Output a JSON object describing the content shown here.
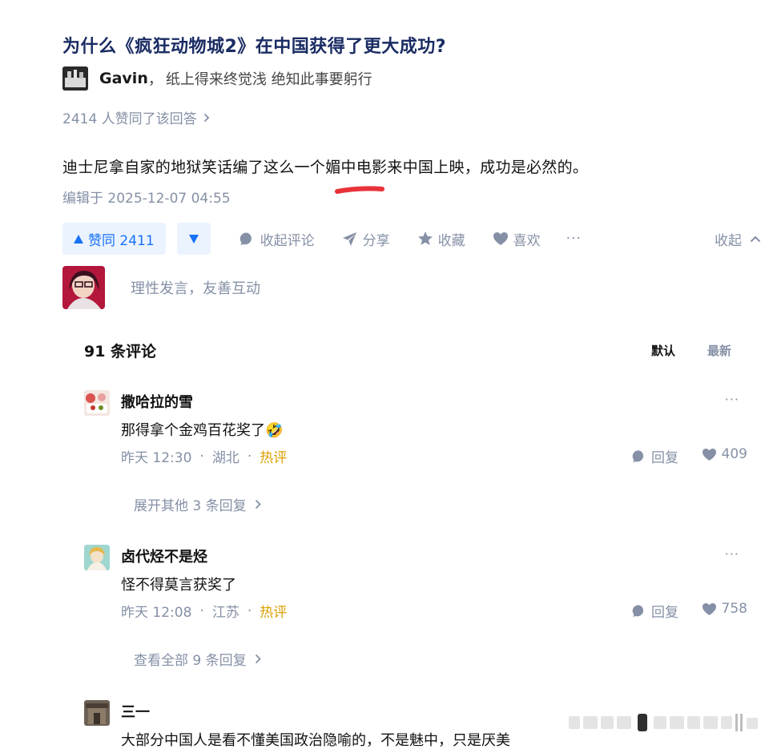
{
  "question": {
    "title": "为什么《疯狂动物城2》在中国获得了更大成功?"
  },
  "author": {
    "name": "Gavin",
    "separator": "，",
    "bio": "纸上得来终觉浅 绝知此事要躬行"
  },
  "upvote_summary": {
    "text": "2414 人赞同了该回答"
  },
  "answer": {
    "content": "迪士尼拿自家的地狱笑话编了这么一个媚中电影来中国上映，成功是必然的。",
    "edited": "编辑于 2025-12-07 04:55"
  },
  "actions": {
    "vote_up_label": "赞同 2411",
    "collapse_comments": "收起评论",
    "share": "分享",
    "favorite": "收藏",
    "like": "喜欢",
    "more": "···",
    "collapse": "收起"
  },
  "comment_input": {
    "placeholder": "理性发言，友善互动"
  },
  "comments_header": {
    "count": "91 条评论",
    "sort_default": "默认",
    "sort_new": "最新"
  },
  "comments": [
    {
      "name": "撒哈拉的雪",
      "text": "那得拿个金鸡百花奖了🤣",
      "time": "昨天 12:30",
      "dot1": "·",
      "location": "湖北",
      "dot2": "·",
      "tag": "热评",
      "reply": "回复",
      "likes": "409",
      "more": "···",
      "expand": "展开其他 3 条回复"
    },
    {
      "name": "卤代烃不是烃",
      "text": "怪不得莫言获奖了",
      "time": "昨天 12:08",
      "dot1": "·",
      "location": "江苏",
      "dot2": "·",
      "tag": "热评",
      "reply": "回复",
      "likes": "758",
      "more": "···",
      "expand": "查看全部 9 条回复"
    },
    {
      "name": "三一",
      "text": "大部分中国人是看不懂美国政治隐喻的，不是魅中，只是厌美"
    }
  ],
  "colors": {
    "link_blue": "#1772f6",
    "title_navy": "#1a2c63",
    "muted_gray": "#8590a6",
    "hot_amber": "#dd9f00",
    "highlight_red": "#e8333a"
  }
}
